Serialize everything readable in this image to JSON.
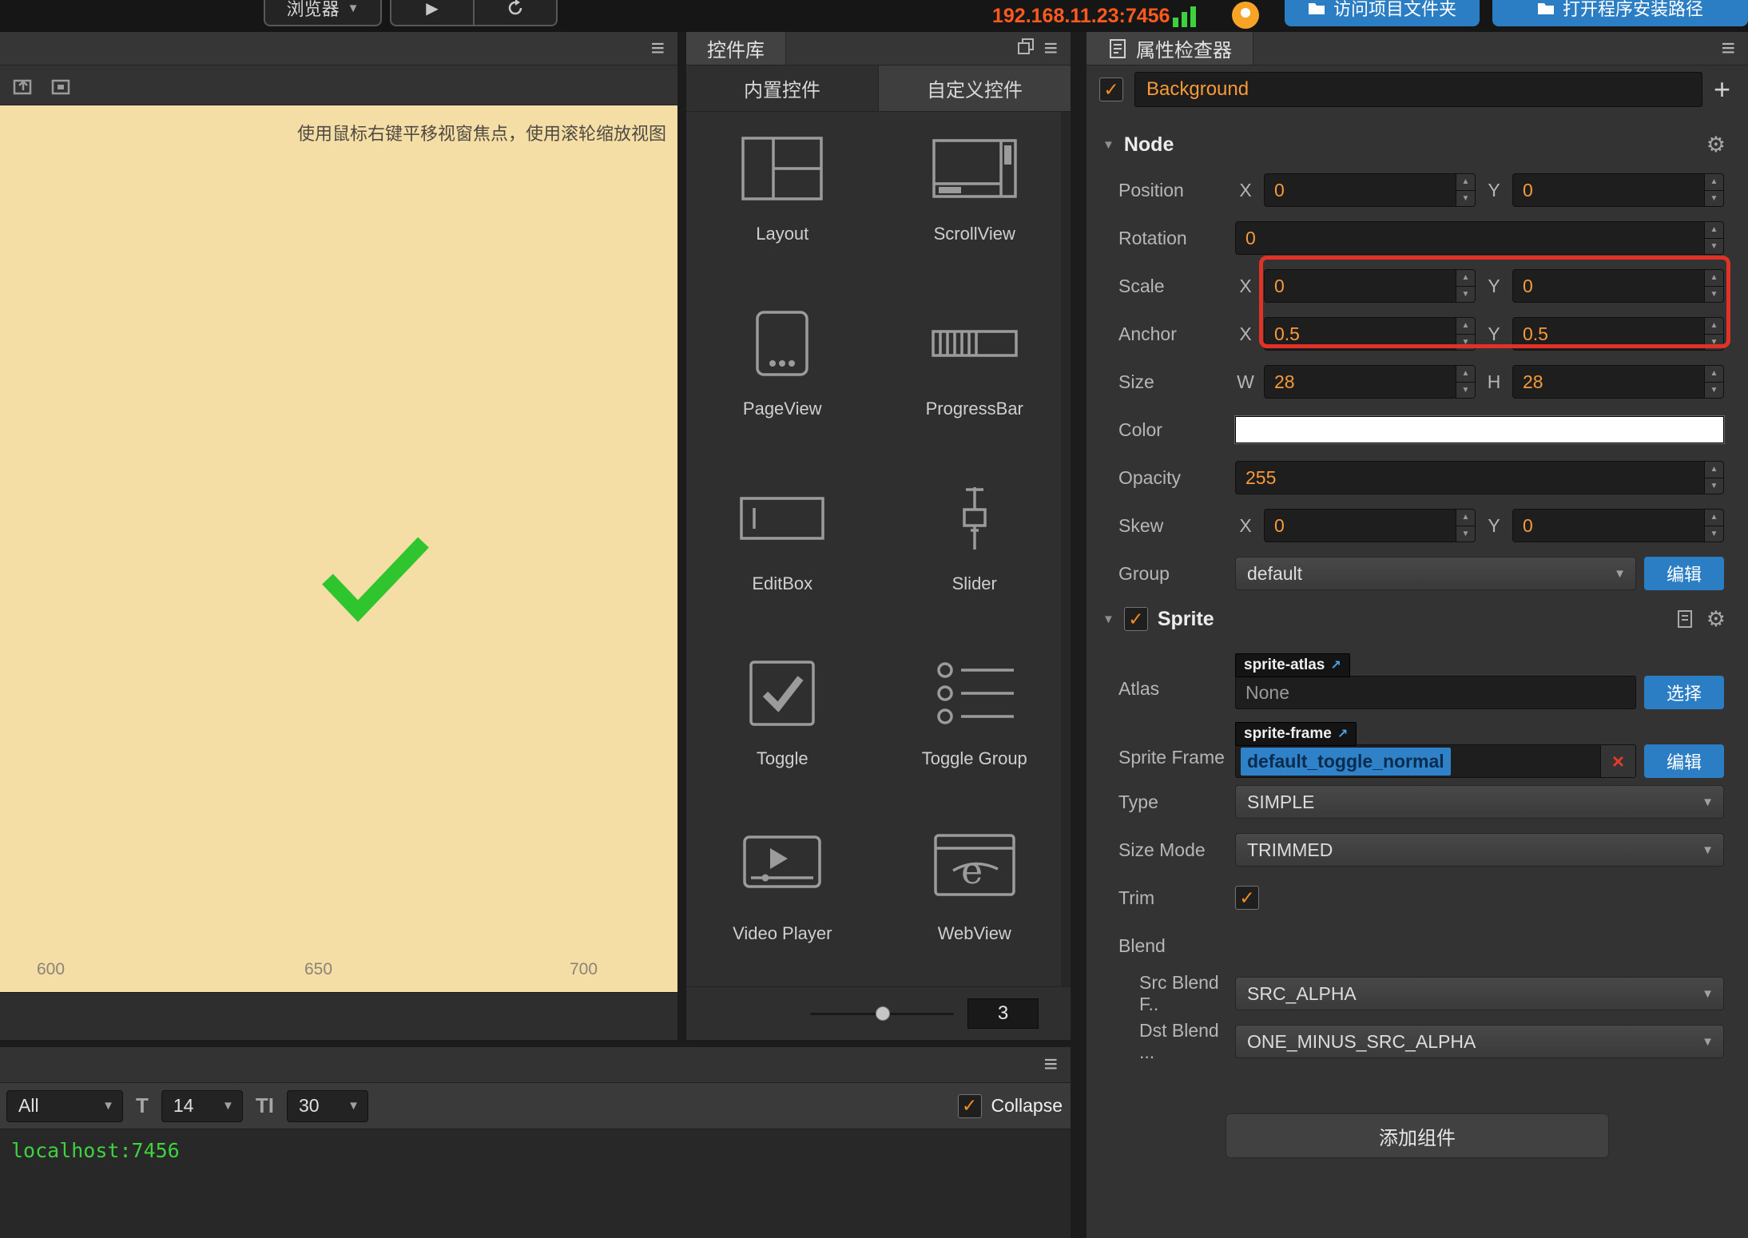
{
  "topbar": {
    "browser_label": "浏览器",
    "ip_address": "192.168.11.23:7456",
    "open_project_button": "访问项目文件夹",
    "open_install_button": "打开程序安装路径"
  },
  "scene": {
    "hint_text": "使用鼠标右键平移视窗焦点，使用滚轮缩放视图",
    "ruler_labels": [
      "600",
      "650",
      "700"
    ]
  },
  "widget_library": {
    "title": "控件库",
    "tab_builtin": "内置控件",
    "tab_custom": "自定义控件",
    "items": [
      {
        "label": "Layout",
        "icon": "layout-icon"
      },
      {
        "label": "ScrollView",
        "icon": "scrollview-icon"
      },
      {
        "label": "PageView",
        "icon": "pageview-icon"
      },
      {
        "label": "ProgressBar",
        "icon": "progressbar-icon"
      },
      {
        "label": "EditBox",
        "icon": "editbox-icon"
      },
      {
        "label": "Slider",
        "icon": "slider-icon"
      },
      {
        "label": "Toggle",
        "icon": "toggle-icon"
      },
      {
        "label": "Toggle Group",
        "icon": "toggle-group-icon"
      },
      {
        "label": "Video Player",
        "icon": "video-player-icon"
      },
      {
        "label": "WebView",
        "icon": "webview-icon"
      }
    ],
    "zoom_value": "3"
  },
  "inspector": {
    "title": "属性检查器",
    "target_name": "Background",
    "node_section": {
      "title": "Node",
      "rows": {
        "position": {
          "label": "Position",
          "x_label": "X",
          "x": "0",
          "y_label": "Y",
          "y": "0"
        },
        "rotation": {
          "label": "Rotation",
          "value": "0"
        },
        "scale": {
          "label": "Scale",
          "x_label": "X",
          "x": "0",
          "y_label": "Y",
          "y": "0"
        },
        "anchor": {
          "label": "Anchor",
          "x_label": "X",
          "x": "0.5",
          "y_label": "Y",
          "y": "0.5"
        },
        "size": {
          "label": "Size",
          "w_label": "W",
          "w": "28",
          "h_label": "H",
          "h": "28"
        },
        "color": {
          "label": "Color",
          "value_hex": "#FFFFFF"
        },
        "opacity": {
          "label": "Opacity",
          "value": "255"
        },
        "skew": {
          "label": "Skew",
          "x_label": "X",
          "x": "0",
          "y_label": "Y",
          "y": "0"
        },
        "group": {
          "label": "Group",
          "value": "default",
          "edit_button": "编辑"
        }
      }
    },
    "sprite_section": {
      "title": "Sprite",
      "rows": {
        "atlas": {
          "label": "Atlas",
          "chip": "sprite-atlas",
          "value": "None",
          "select_button": "选择"
        },
        "sprite_frame": {
          "label": "Sprite Frame",
          "chip": "sprite-frame",
          "value": "default_toggle_normal",
          "edit_button": "编辑"
        },
        "type": {
          "label": "Type",
          "value": "SIMPLE"
        },
        "size_mode": {
          "label": "Size Mode",
          "value": "TRIMMED"
        },
        "trim": {
          "label": "Trim"
        },
        "blend": {
          "label": "Blend"
        },
        "src_blend": {
          "label": "Src Blend F..",
          "value": "SRC_ALPHA"
        },
        "dst_blend": {
          "label": "Dst Blend ...",
          "value": "ONE_MINUS_SRC_ALPHA"
        }
      }
    },
    "add_component_button": "添加组件",
    "colors": {
      "accent_orange": "#f89a38",
      "annotation_red": "#e23227",
      "selection_blue": "#2f82c7"
    }
  },
  "console": {
    "filter_value": "All",
    "font_size_value": "14",
    "line_height_value": "30",
    "collapse_label": "Collapse",
    "log_line": "localhost:7456",
    "icons": {
      "font_size": "T",
      "line_height": "TI"
    }
  }
}
